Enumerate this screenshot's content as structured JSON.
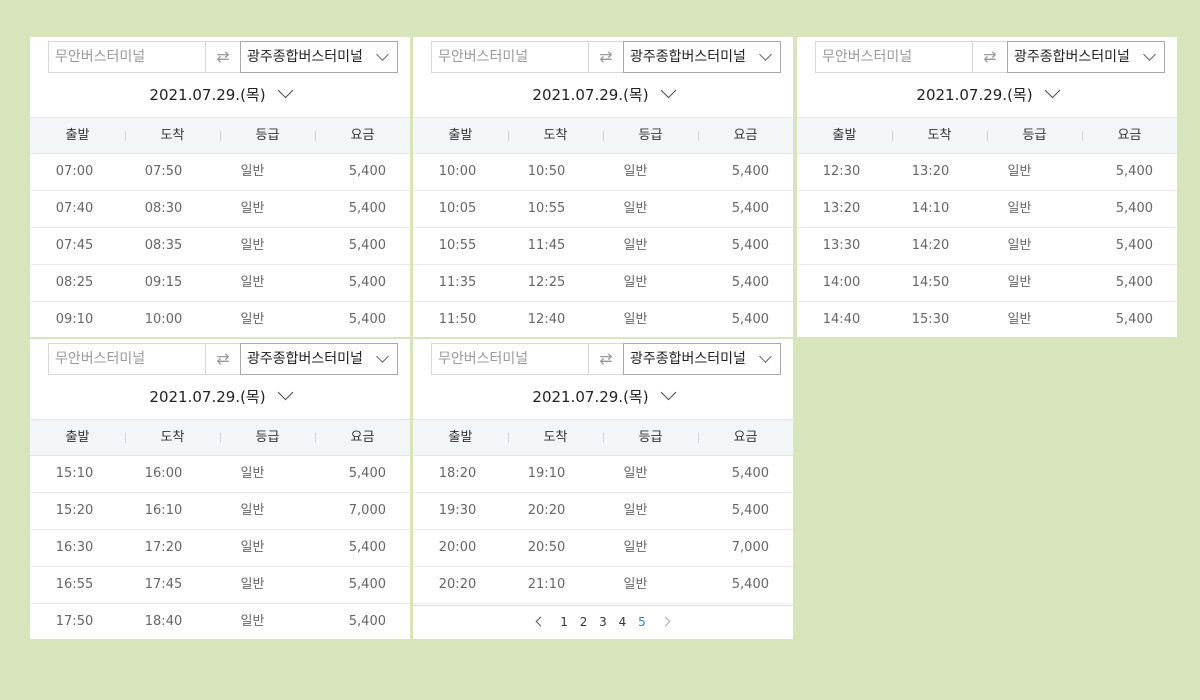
{
  "origin_placeholder": "무안버스터미널",
  "swap_icon": "⇄",
  "destination": "광주종합버스터미널",
  "date": "2021.07.29.(목)",
  "headers": [
    "출발",
    "도착",
    "등급",
    "요금"
  ],
  "panels": [
    {
      "rows": [
        [
          "07:00",
          "07:50",
          "일반",
          "5,400"
        ],
        [
          "07:40",
          "08:30",
          "일반",
          "5,400"
        ],
        [
          "07:45",
          "08:35",
          "일반",
          "5,400"
        ],
        [
          "08:25",
          "09:15",
          "일반",
          "5,400"
        ],
        [
          "09:10",
          "10:00",
          "일반",
          "5,400"
        ]
      ]
    },
    {
      "rows": [
        [
          "10:00",
          "10:50",
          "일반",
          "5,400"
        ],
        [
          "10:05",
          "10:55",
          "일반",
          "5,400"
        ],
        [
          "10:55",
          "11:45",
          "일반",
          "5,400"
        ],
        [
          "11:35",
          "12:25",
          "일반",
          "5,400"
        ],
        [
          "11:50",
          "12:40",
          "일반",
          "5,400"
        ]
      ]
    },
    {
      "rows": [
        [
          "12:30",
          "13:20",
          "일반",
          "5,400"
        ],
        [
          "13:20",
          "14:10",
          "일반",
          "5,400"
        ],
        [
          "13:30",
          "14:20",
          "일반",
          "5,400"
        ],
        [
          "14:00",
          "14:50",
          "일반",
          "5,400"
        ],
        [
          "14:40",
          "15:30",
          "일반",
          "5,400"
        ]
      ]
    },
    {
      "rows": [
        [
          "15:10",
          "16:00",
          "일반",
          "5,400"
        ],
        [
          "15:20",
          "16:10",
          "일반",
          "7,000"
        ],
        [
          "16:30",
          "17:20",
          "일반",
          "5,400"
        ],
        [
          "16:55",
          "17:45",
          "일반",
          "5,400"
        ],
        [
          "17:50",
          "18:40",
          "일반",
          "5,400"
        ]
      ]
    },
    {
      "rows": [
        [
          "18:20",
          "19:10",
          "일반",
          "5,400"
        ],
        [
          "19:30",
          "20:20",
          "일반",
          "5,400"
        ],
        [
          "20:00",
          "20:50",
          "일반",
          "7,000"
        ],
        [
          "20:20",
          "21:10",
          "일반",
          "5,400"
        ]
      ]
    }
  ],
  "pagination": {
    "pages": [
      "1",
      "2",
      "3",
      "4",
      "5"
    ],
    "current": "5"
  },
  "colors": {
    "background": "#d8e4bc",
    "header_bg": "#f2f6f9",
    "active_page": "#2f7fd6"
  }
}
